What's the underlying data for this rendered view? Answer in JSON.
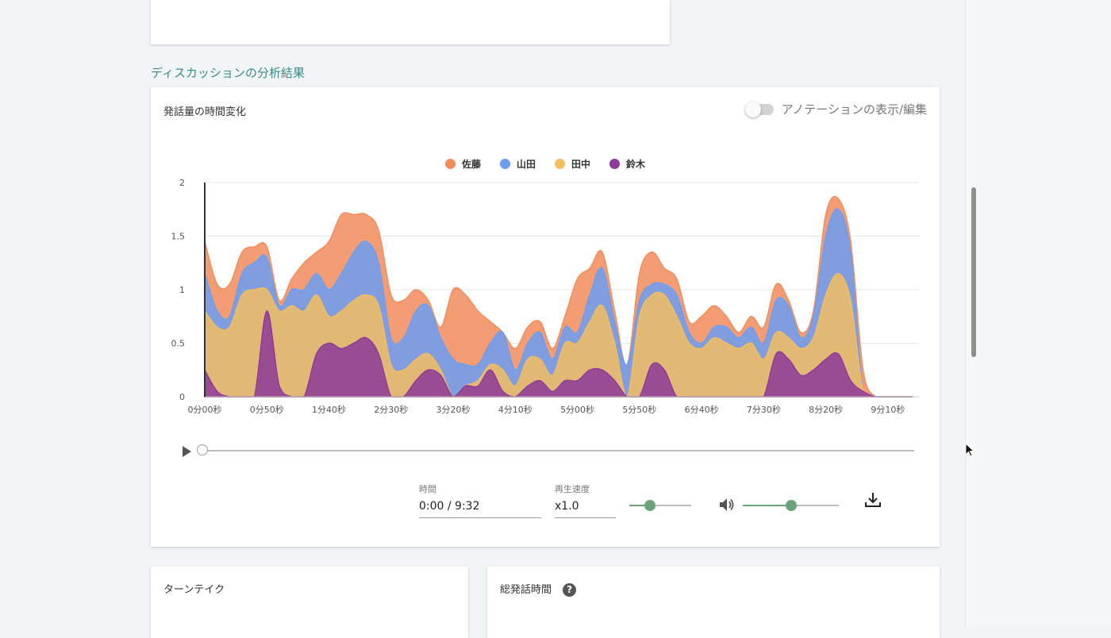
{
  "section_title": "ディスカッションの分析結果",
  "main_card": {
    "title": "発話量の時間変化",
    "annotation_toggle_label": "アノテーションの表示/編集",
    "annotation_toggle_on": false
  },
  "chart_data": {
    "type": "area",
    "stacked": true,
    "legend_position": "top-center",
    "grid": true,
    "ylim": [
      0,
      2
    ],
    "y_ticks": [
      "0",
      "0.5",
      "1",
      "1.5",
      "2"
    ],
    "x_tick_labels": [
      "0分00秒",
      "0分50秒",
      "1分40秒",
      "2分30秒",
      "3分20秒",
      "4分10秒",
      "5分00秒",
      "5分50秒",
      "6分40秒",
      "7分30秒",
      "8分20秒",
      "9分10秒"
    ],
    "x_tick_seconds": [
      0,
      50,
      100,
      150,
      200,
      250,
      300,
      350,
      400,
      450,
      500,
      550
    ],
    "x_seconds": [
      0,
      10,
      20,
      30,
      40,
      50,
      60,
      70,
      80,
      90,
      100,
      110,
      120,
      130,
      140,
      150,
      160,
      170,
      180,
      190,
      200,
      210,
      220,
      230,
      240,
      250,
      260,
      270,
      280,
      290,
      300,
      310,
      320,
      330,
      340,
      350,
      360,
      370,
      380,
      390,
      400,
      410,
      420,
      430,
      440,
      450,
      460,
      470,
      480,
      490,
      500,
      510,
      520,
      530,
      540,
      550,
      560,
      570
    ],
    "series": [
      {
        "name": "鈴木",
        "color": "#8e3a9a",
        "values": [
          0.25,
          0.05,
          0,
          0,
          0,
          0.8,
          0.1,
          0,
          0,
          0.4,
          0.5,
          0.45,
          0.5,
          0.55,
          0.4,
          0,
          0,
          0.15,
          0.25,
          0.2,
          0,
          0.1,
          0.1,
          0.25,
          0.05,
          0,
          0.1,
          0.15,
          0.05,
          0.15,
          0.15,
          0.25,
          0.25,
          0.15,
          0,
          0,
          0.3,
          0.25,
          0,
          0,
          0,
          0,
          0,
          0,
          0,
          0,
          0.4,
          0.35,
          0.2,
          0.25,
          0.35,
          0.4,
          0.15,
          0.05,
          0,
          0,
          0,
          0
        ]
      },
      {
        "name": "田中",
        "color": "#f2be62",
        "values": [
          0.55,
          0.6,
          0.65,
          0.95,
          1.0,
          0.2,
          0.7,
          0.85,
          0.8,
          0.55,
          0.25,
          0.35,
          0.4,
          0.4,
          0.45,
          0.3,
          0.25,
          0.2,
          0.15,
          0.05,
          0,
          0,
          0.05,
          0.05,
          0.2,
          0.1,
          0.25,
          0.2,
          0.15,
          0.35,
          0.35,
          0.45,
          0.6,
          0.35,
          0,
          0.75,
          0.65,
          0.7,
          0.75,
          0.5,
          0.45,
          0.55,
          0.5,
          0.45,
          0.5,
          0.35,
          0.2,
          0.2,
          0.25,
          0.3,
          0.6,
          0.75,
          0.75,
          0,
          0,
          0,
          0,
          0
        ]
      },
      {
        "name": "山田",
        "color": "#6b9ef2",
        "values": [
          0.35,
          0.15,
          0.1,
          0.2,
          0.25,
          0.3,
          0.05,
          0.15,
          0.2,
          0.2,
          0.25,
          0.35,
          0.45,
          0.5,
          0.4,
          0.25,
          0.3,
          0.45,
          0.45,
          0.3,
          0.35,
          0.2,
          0.15,
          0.2,
          0.35,
          0.15,
          0.15,
          0.25,
          0.15,
          0.15,
          0.1,
          0.25,
          0.35,
          0.2,
          0.3,
          0.15,
          0.1,
          0.1,
          0.2,
          0.1,
          0.05,
          0.1,
          0.15,
          0.1,
          0.15,
          0.15,
          0.3,
          0.3,
          0.1,
          0.2,
          0.55,
          0.6,
          0.45,
          0,
          0,
          0,
          0,
          0
        ]
      },
      {
        "name": "佐藤",
        "color": "#f28c5c",
        "values": [
          0.3,
          0.25,
          0.3,
          0.2,
          0.15,
          0.1,
          0.05,
          0.1,
          0.25,
          0.2,
          0.45,
          0.55,
          0.35,
          0.25,
          0.3,
          0.4,
          0.35,
          0.2,
          0.05,
          0.1,
          0.65,
          0.65,
          0.5,
          0.2,
          0,
          0.2,
          0.15,
          0.1,
          0.1,
          0.1,
          0.5,
          0.25,
          0.15,
          0.1,
          0,
          0.25,
          0.3,
          0.15,
          0.15,
          0.1,
          0.25,
          0.2,
          0.1,
          0.05,
          0.1,
          0.15,
          0.15,
          0.05,
          0.05,
          0.05,
          0.2,
          0.1,
          0.1,
          0.2,
          0,
          0,
          0,
          0
        ]
      }
    ],
    "legend_order": [
      "佐藤",
      "山田",
      "田中",
      "鈴木"
    ]
  },
  "player": {
    "time_label": "時間",
    "time_value": "0:00 / 9:32",
    "speed_label": "再生速度",
    "speed_value": "x1.0",
    "speed_slider_level": 0.33,
    "volume_slider_level": 0.5,
    "progress": 0
  },
  "icons": {
    "play": "play-icon",
    "volume": "volume-icon",
    "download": "download-icon",
    "help": "help-icon",
    "help_glyph": "?"
  },
  "bottom_cards": {
    "turn_take_title": "ターンテイク",
    "total_speech_title": "総発話時間"
  }
}
